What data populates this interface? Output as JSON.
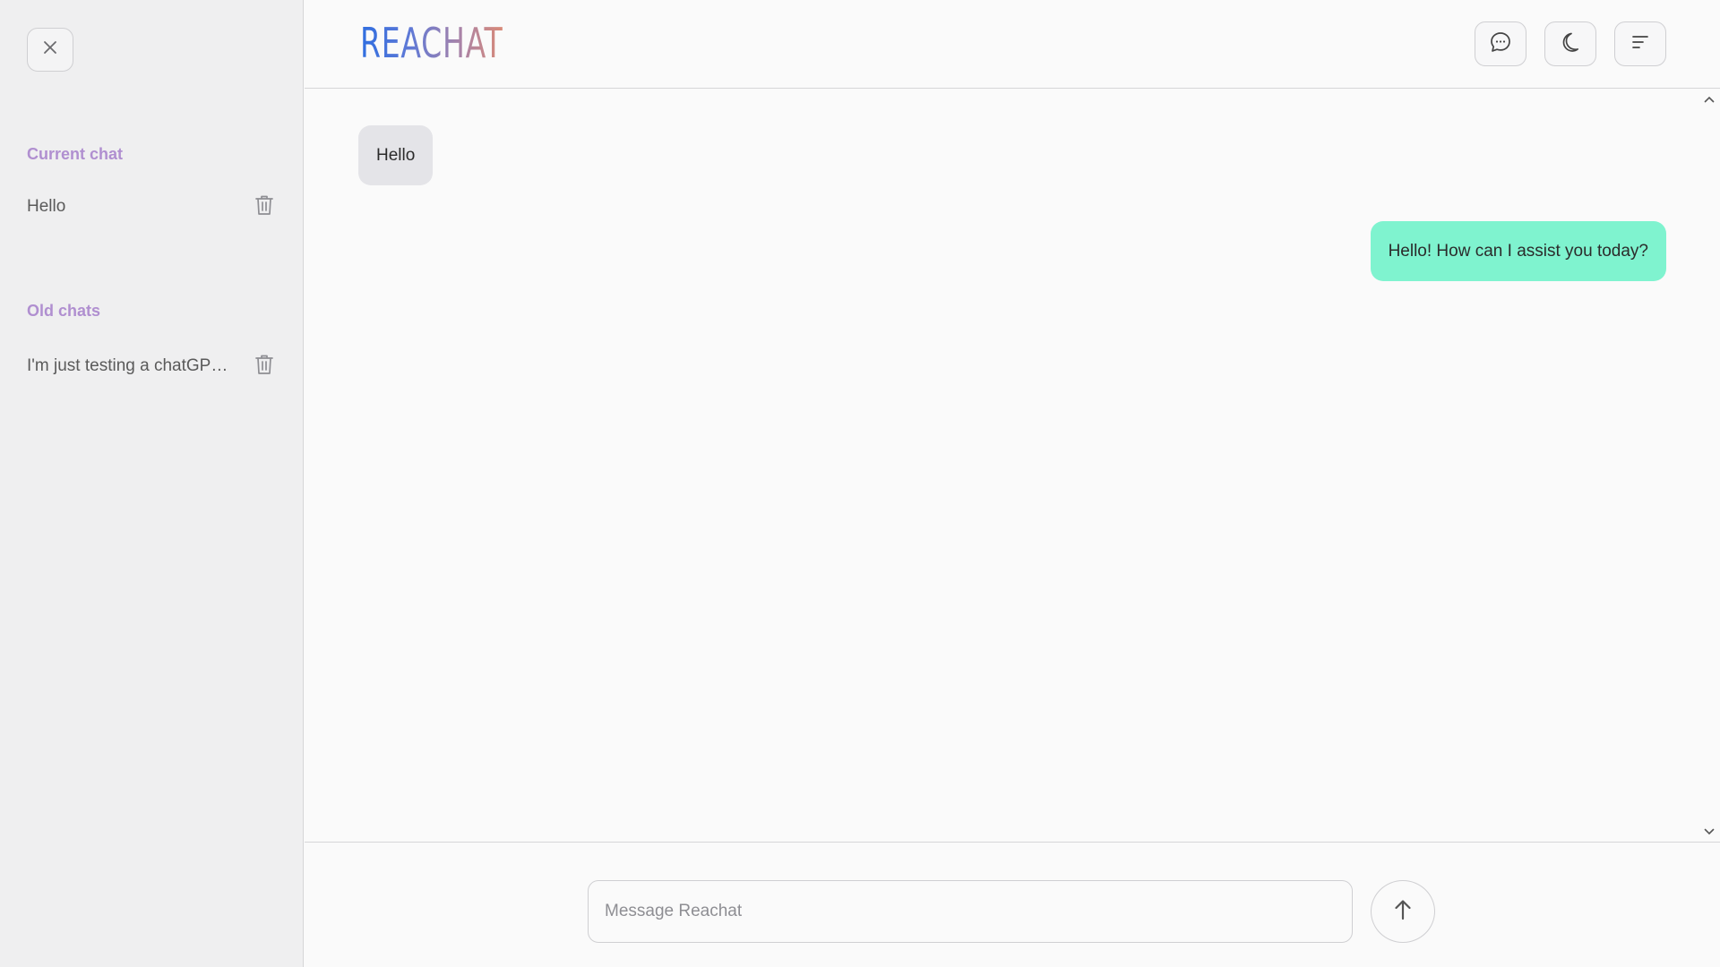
{
  "app": {
    "logo_text": "REACHAT"
  },
  "sidebar": {
    "close_icon": "close-icon",
    "current_heading": "Current chat",
    "current_chats": [
      {
        "label": "Hello",
        "icon": "trash-icon"
      }
    ],
    "old_heading": "Old chats",
    "old_chats": [
      {
        "label": "I'm just testing a chatGPT clone",
        "icon": "trash-icon"
      }
    ]
  },
  "header": {
    "buttons": [
      {
        "icon": "chat-bubble-icon"
      },
      {
        "icon": "moon-icon"
      },
      {
        "icon": "menu-icon"
      }
    ]
  },
  "chat": {
    "messages": [
      {
        "role": "user",
        "text": "Hello"
      },
      {
        "role": "assistant",
        "text": "Hello! How can I assist you today?"
      }
    ]
  },
  "composer": {
    "placeholder": "Message Reachat",
    "value": "",
    "send_icon": "arrow-up-icon"
  },
  "colors": {
    "accent_heading": "#b08fd0",
    "assistant_bubble": "#7ff3cf",
    "user_bubble": "#e4e4e8",
    "sidebar_bg": "#efeff0",
    "logo_gradient_start": "#2f6ee0",
    "logo_gradient_end": "#d98a78"
  }
}
